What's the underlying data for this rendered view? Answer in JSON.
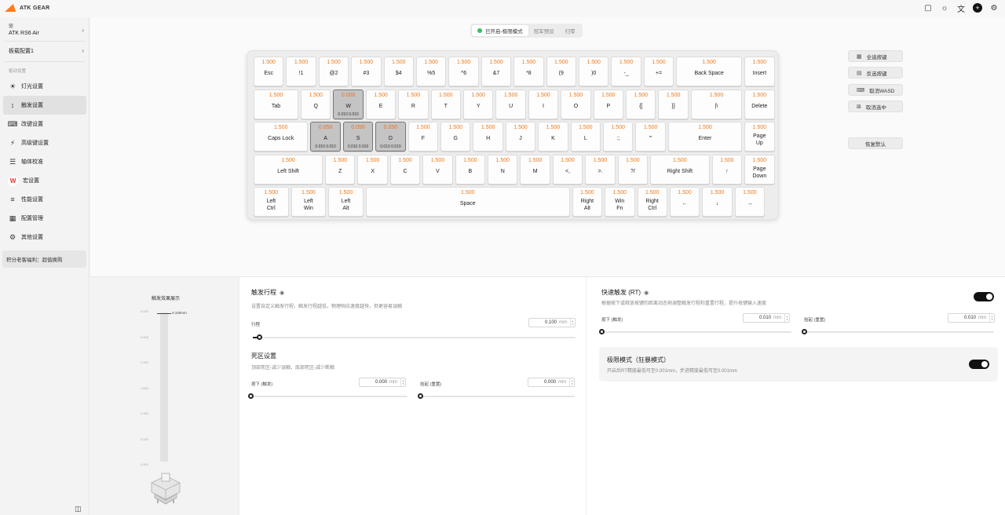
{
  "app": {
    "logo_text": "ATK GEAR"
  },
  "topbar_icons": [
    "shirt-icon",
    "sun-icon",
    "translate-icon",
    "add-icon",
    "settings-icon"
  ],
  "sidebar": {
    "device_label": "驱",
    "device_name": "ATK RS6 Air",
    "board_config": "板载配置1",
    "section_title": "驱动设置",
    "items": [
      {
        "label": "灯光设置",
        "icon": "bulb-icon",
        "glyph": "☀"
      },
      {
        "label": "触发设置",
        "icon": "trigger-icon",
        "glyph": "↕"
      },
      {
        "label": "改键设置",
        "icon": "keyboard-icon",
        "glyph": "⌨"
      },
      {
        "label": "高级键设置",
        "icon": "advanced-key-icon",
        "glyph": "⚡"
      },
      {
        "label": "轴体校准",
        "icon": "calibrate-icon",
        "glyph": "☰"
      },
      {
        "label": "宏设置",
        "icon": "macro-icon",
        "glyph": "W"
      },
      {
        "label": "性能设置",
        "icon": "sliders-icon",
        "glyph": "≡"
      },
      {
        "label": "配置管理",
        "icon": "grid-icon",
        "glyph": "▦"
      },
      {
        "label": "其他设置",
        "icon": "gear-icon",
        "glyph": "⚙"
      }
    ],
    "active_index": 1,
    "promo": "积分老客福利：超值换购"
  },
  "tabs": [
    {
      "label": "已开启-极限模式",
      "active": true
    },
    {
      "label": "冠军预设",
      "active": false
    },
    {
      "label": "归零",
      "active": false
    }
  ],
  "keyboard": {
    "rows": [
      [
        {
          "v": "1.500",
          "n": "Esc",
          "w": 1
        },
        {
          "v": "1.500",
          "n": "!1",
          "w": 1
        },
        {
          "v": "1.500",
          "n": "@2",
          "w": 1
        },
        {
          "v": "1.500",
          "n": "#3",
          "w": 1
        },
        {
          "v": "1.500",
          "n": "$4",
          "w": 1
        },
        {
          "v": "1.500",
          "n": "%5",
          "w": 1
        },
        {
          "v": "1.500",
          "n": "^6",
          "w": 1
        },
        {
          "v": "1.500",
          "n": "&7",
          "w": 1
        },
        {
          "v": "1.500",
          "n": "*8",
          "w": 1
        },
        {
          "v": "1.500",
          "n": "(9",
          "w": 1
        },
        {
          "v": "1.500",
          "n": ")0",
          "w": 1
        },
        {
          "v": "1.500",
          "n": "-_",
          "w": 1
        },
        {
          "v": "1.500",
          "n": "+=",
          "w": 1
        },
        {
          "v": "1.500",
          "n": "Back Space",
          "w": 2.1
        },
        {
          "v": "1.500",
          "n": "Insert",
          "w": 1
        }
      ],
      [
        {
          "v": "1.500",
          "n": "Tab",
          "w": 1.45
        },
        {
          "v": "1.500",
          "n": "Q",
          "w": 1
        },
        {
          "v": "0.000",
          "n": "W",
          "w": 1,
          "sel": true,
          "s": "0.010 0.010"
        },
        {
          "v": "1.500",
          "n": "E",
          "w": 1
        },
        {
          "v": "1.500",
          "n": "R",
          "w": 1
        },
        {
          "v": "1.500",
          "n": "T",
          "w": 1
        },
        {
          "v": "1.500",
          "n": "Y",
          "w": 1
        },
        {
          "v": "1.500",
          "n": "U",
          "w": 1
        },
        {
          "v": "1.500",
          "n": "I",
          "w": 1
        },
        {
          "v": "1.500",
          "n": "O",
          "w": 1
        },
        {
          "v": "1.500",
          "n": "P",
          "w": 1
        },
        {
          "v": "1.500",
          "n": "{[",
          "w": 1
        },
        {
          "v": "1.500",
          "n": "}]",
          "w": 1
        },
        {
          "v": "1.500",
          "n": "|\\",
          "w": 1.65
        },
        {
          "v": "1.500",
          "n": "Delete",
          "w": 1
        }
      ],
      [
        {
          "v": "1.500",
          "n": "Caps Lock",
          "w": 1.75
        },
        {
          "v": "0.050",
          "n": "A",
          "w": 1,
          "sel": true,
          "s": "0.010 0.010"
        },
        {
          "v": "0.050",
          "n": "S",
          "w": 1,
          "sel": true,
          "s": "0.010 0.010"
        },
        {
          "v": "0.050",
          "n": "D",
          "w": 1,
          "sel": true,
          "s": "0.010 0.010"
        },
        {
          "v": "1.500",
          "n": "F",
          "w": 1
        },
        {
          "v": "1.500",
          "n": "G",
          "w": 1
        },
        {
          "v": "1.500",
          "n": "H",
          "w": 1
        },
        {
          "v": "1.500",
          "n": "J",
          "w": 1
        },
        {
          "v": "1.500",
          "n": "K",
          "w": 1
        },
        {
          "v": "1.500",
          "n": "L",
          "w": 1
        },
        {
          "v": "1.500",
          "n": ":;",
          "w": 1
        },
        {
          "v": "1.500",
          "n": "\"'",
          "w": 1
        },
        {
          "v": "1.500",
          "n": "Enter",
          "w": 2.35
        },
        {
          "v": "1.500",
          "n": "Page\nUp",
          "w": 1
        }
      ],
      [
        {
          "v": "1.500",
          "n": "Left Shift",
          "w": 2.2
        },
        {
          "v": "1.500",
          "n": "Z",
          "w": 1
        },
        {
          "v": "1.500",
          "n": "X",
          "w": 1
        },
        {
          "v": "1.500",
          "n": "C",
          "w": 1
        },
        {
          "v": "1.500",
          "n": "V",
          "w": 1
        },
        {
          "v": "1.500",
          "n": "B",
          "w": 1
        },
        {
          "v": "1.500",
          "n": "N",
          "w": 1
        },
        {
          "v": "1.500",
          "n": "M",
          "w": 1
        },
        {
          "v": "1.500",
          "n": "<,",
          "w": 1
        },
        {
          "v": "1.500",
          "n": ">.",
          "w": 1
        },
        {
          "v": "1.500",
          "n": "?/",
          "w": 1
        },
        {
          "v": "1.500",
          "n": "Right Shift",
          "w": 1.9
        },
        {
          "v": "1.500",
          "n": "↑",
          "w": 1
        },
        {
          "v": "1.500",
          "n": "Page\nDown",
          "w": 1
        }
      ],
      [
        {
          "v": "1.500",
          "n": "Left\nCtrl",
          "w": 1.15
        },
        {
          "v": "1.500",
          "n": "Left\nWin",
          "w": 1.15
        },
        {
          "v": "1.500",
          "n": "Left\nAlt",
          "w": 1.15
        },
        {
          "v": "1.500",
          "n": "Space",
          "w": 6.35
        },
        {
          "v": "1.500",
          "n": "Right\nAlt",
          "w": 1
        },
        {
          "v": "1.500",
          "n": "Win\nFn",
          "w": 1
        },
        {
          "v": "1.500",
          "n": "Right\nCtrl",
          "w": 1
        },
        {
          "v": "1.500",
          "n": "←",
          "w": 1
        },
        {
          "v": "1.500",
          "n": "↓",
          "w": 1
        },
        {
          "v": "1.500",
          "n": "→",
          "w": 1
        }
      ]
    ]
  },
  "side_buttons": {
    "select_all": "全选按键",
    "invert": "反选按键",
    "cancel_wasd": "取消WASD",
    "cancel_selected": "取消选中",
    "restore_default": "恢复默认"
  },
  "preview": {
    "title": "触发效果展示",
    "ticks": [
      "0.000",
      "0.600",
      "1.200",
      "1.800",
      "2.400",
      "3.000",
      "3.600"
    ],
    "current": "0.100mm"
  },
  "trigger": {
    "title": "触发行程",
    "desc": "设置自定义触发行程，触发行程越低，物理响应速度越快，但更容易误触",
    "travel_label": "行程",
    "travel_value": "0.100",
    "unit": "mm",
    "travel_fraction": 0.02
  },
  "deadzone": {
    "title": "死区设置",
    "desc": "顶部死区-减少误触，底部死区-减少断触",
    "press_label": "按下 (触发)",
    "press_value": "0.000",
    "release_label": "抬起 (重置)",
    "release_value": "0.000",
    "unit": "mm"
  },
  "rapid": {
    "title": "快速触发 (RT)",
    "desc": "根据按下或释放按键的距离动态地调整触发行程和重置行程，提升按键输入速度",
    "enabled": true,
    "press_label": "按下 (触发)",
    "press_value": "0.010",
    "release_label": "抬起 (重置)",
    "release_value": "0.010",
    "unit": "mm"
  },
  "extreme": {
    "title": "极限模式（狂暴模式）",
    "desc": "开启后RT精度最低可至0.001mm，步进精度最低可至0.001mm",
    "enabled": true
  },
  "colors": {
    "accent": "#f07a1a",
    "status_green": "#37c15a",
    "toggle_on": "#111111"
  }
}
